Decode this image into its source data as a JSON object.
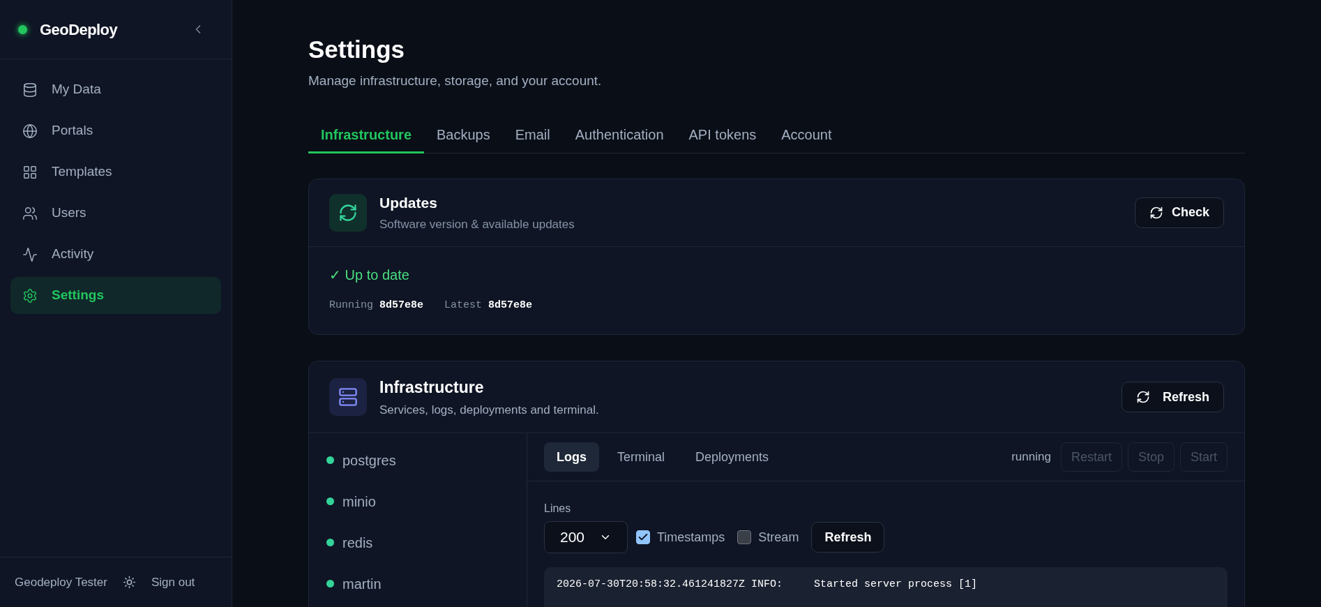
{
  "sidebar": {
    "brand": "GeoDeploy",
    "online": true,
    "items": [
      {
        "label": "My Data",
        "selected": false
      },
      {
        "label": "Portals",
        "selected": false
      },
      {
        "label": "Templates",
        "selected": false
      },
      {
        "label": "Users",
        "selected": false
      },
      {
        "label": "Activity",
        "selected": false
      },
      {
        "label": "Settings",
        "selected": true
      }
    ],
    "user": "Geodeploy Tester",
    "sign_out": "Sign out"
  },
  "page": {
    "title": "Settings",
    "subtitle": "Manage infrastructure, storage, and your account."
  },
  "tabs": [
    {
      "label": "Infrastructure",
      "selected": true
    },
    {
      "label": "Backups",
      "selected": false
    },
    {
      "label": "Email",
      "selected": false
    },
    {
      "label": "Authentication",
      "selected": false
    },
    {
      "label": "API tokens",
      "selected": false
    },
    {
      "label": "Account",
      "selected": false
    }
  ],
  "updates": {
    "title": "Updates",
    "subtitle": "Software version & available updates",
    "button": "Check",
    "status": "✓ Up to date",
    "running_label": "Running",
    "running_value": "8d57e8e",
    "latest_label": "Latest",
    "latest_value": "8d57e8e"
  },
  "infrastructure": {
    "title": "Infrastructure",
    "subtitle": "Services, logs, deployments and terminal.",
    "button": "Refresh",
    "services": [
      {
        "name": "postgres",
        "color": "#34d399"
      },
      {
        "name": "minio",
        "color": "#34d399"
      },
      {
        "name": "redis",
        "color": "#34d399"
      },
      {
        "name": "martin",
        "color": "#34d399"
      }
    ],
    "subtabs": [
      {
        "label": "Logs",
        "selected": true
      },
      {
        "label": "Terminal",
        "selected": false
      },
      {
        "label": "Deployments",
        "selected": false
      }
    ],
    "status": "running",
    "actions": [
      {
        "label": "Restart",
        "disabled": true
      },
      {
        "label": "Stop",
        "disabled": true
      },
      {
        "label": "Start",
        "disabled": true
      }
    ],
    "lines_label": "Lines",
    "lines_value": "200",
    "timestamps": {
      "label": "Timestamps",
      "checked": true
    },
    "stream": {
      "label": "Stream",
      "checked": false
    },
    "refresh_button": "Refresh",
    "log_lines": [
      "2026-07-30T20:58:32.461241827Z INFO:     Started server process [1]"
    ]
  }
}
